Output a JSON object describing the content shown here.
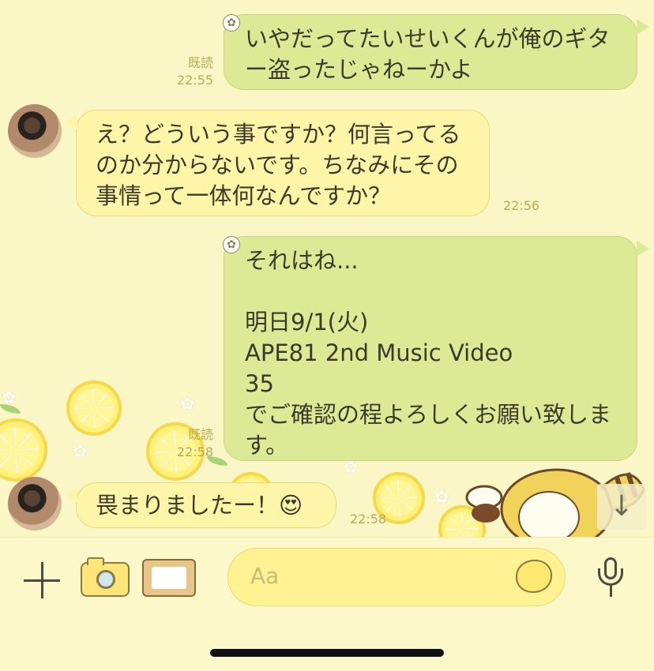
{
  "messages": [
    {
      "side": "out",
      "text": "いやだってたいせいくんが俺のギター盗ったじゃねーかよ",
      "read": "既読",
      "time": "22:55"
    },
    {
      "side": "in",
      "text": "え？どういう事ですか？何言ってるのか分からないです。ちなみにその事情って一体何なんですか？",
      "time": "22:56"
    },
    {
      "side": "out",
      "text": "それはね...\n\n明日9/1(火)\nAPE81 2nd Music Video\n35\nでご確認の程よろしくお願い致します。",
      "read": "既読",
      "time": "22:58"
    },
    {
      "side": "in",
      "text": "畏まりましたー！😍",
      "time": "22:58"
    }
  ],
  "input": {
    "placeholder": "Aa"
  },
  "icons": {
    "add": "plus-icon",
    "camera": "camera-icon",
    "photo": "photo-frame-icon",
    "emoji": "lemon-sticker-icon",
    "voice": "microphone-icon",
    "scroll": "arrow-down-icon"
  },
  "scroll_arrow": "↓"
}
